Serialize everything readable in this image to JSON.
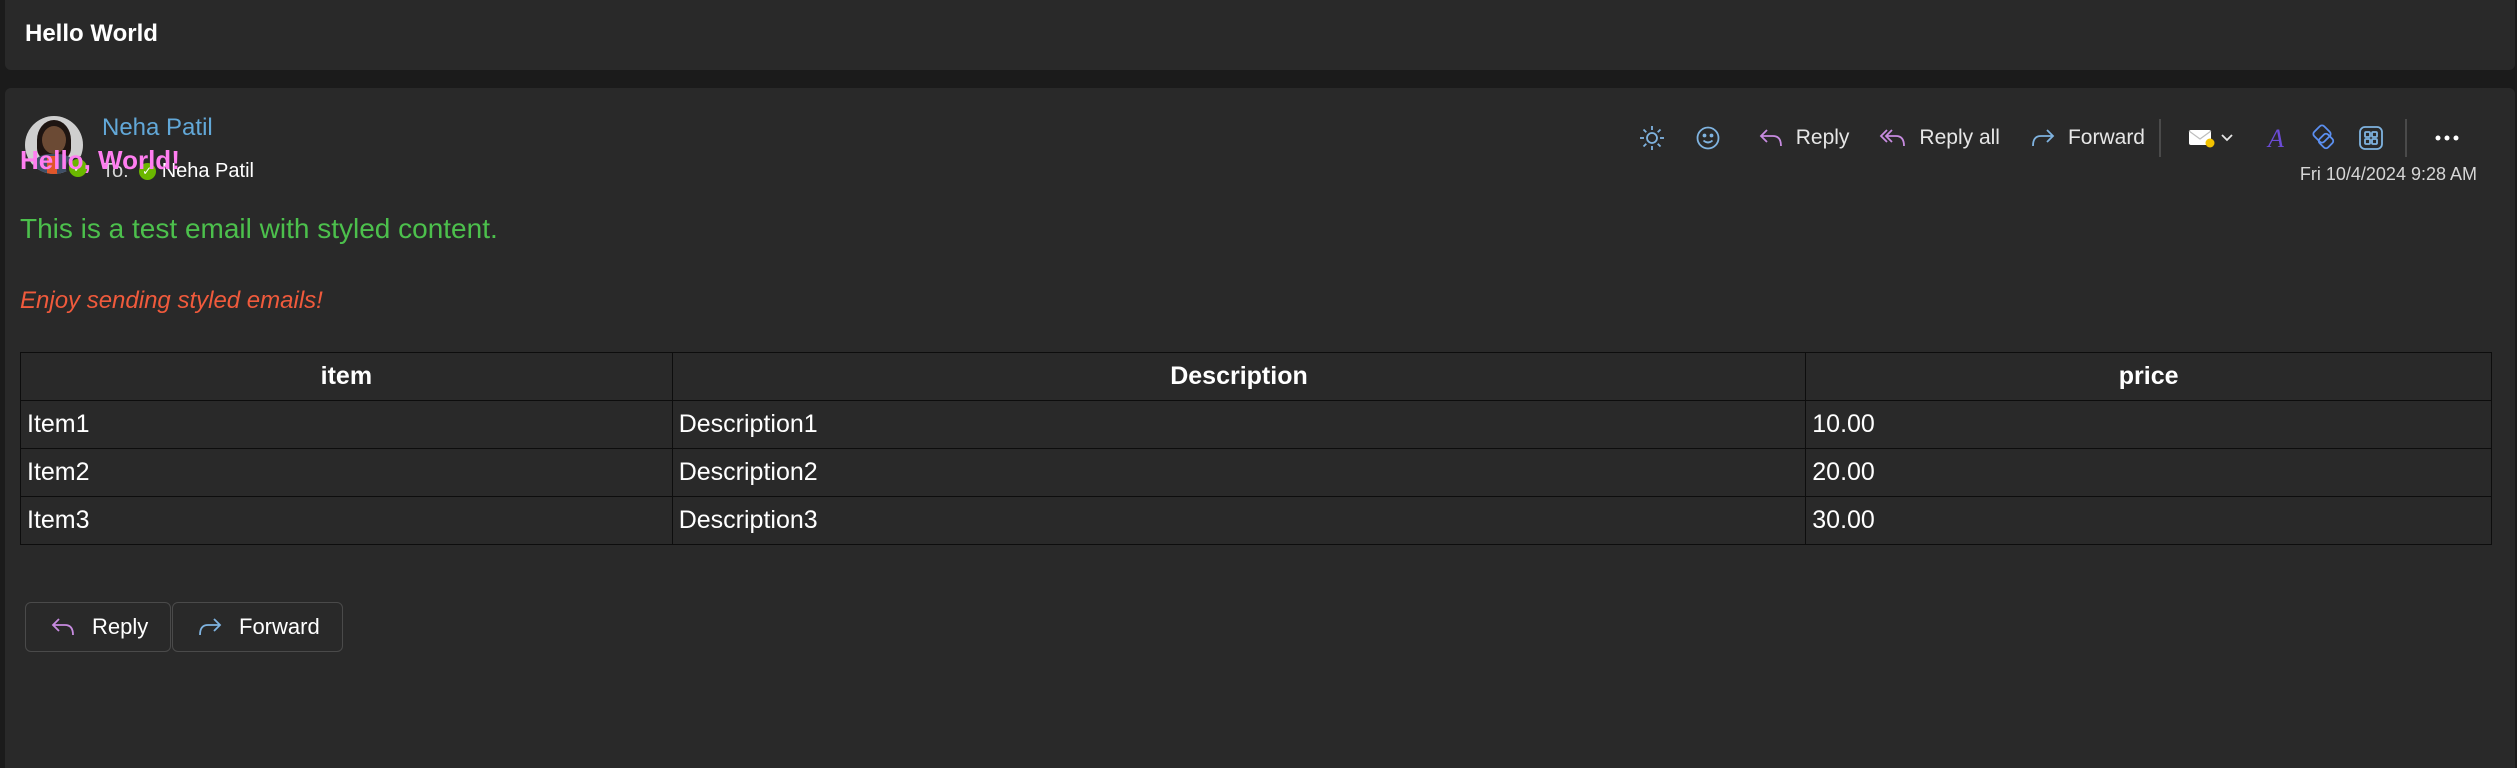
{
  "subject": "Hello World",
  "sender": {
    "name": "Neha Patil",
    "to_label": "To:",
    "recipient": "Neha Patil"
  },
  "toolbar": {
    "reply": "Reply",
    "reply_all": "Reply all",
    "forward": "Forward"
  },
  "date": "Fri 10/4/2024 9:28 AM",
  "body": {
    "heading": "Hello, World!",
    "paragraph": "This is a test email with styled content.",
    "italic": "Enjoy sending styled emails!"
  },
  "table": {
    "headers": [
      "item",
      "Description",
      "price"
    ],
    "rows": [
      [
        "Item1",
        "Description1",
        "10.00"
      ],
      [
        "Item2",
        "Description2",
        "20.00"
      ],
      [
        "Item3",
        "Description3",
        "30.00"
      ]
    ]
  },
  "actions": {
    "reply": "Reply",
    "forward": "Forward"
  },
  "colors": {
    "heading": "#ff7ef0",
    "paragraph": "#4cc04c",
    "italic": "#f05a3c",
    "sender": "#62a8d8",
    "presence": "#6bb700"
  }
}
